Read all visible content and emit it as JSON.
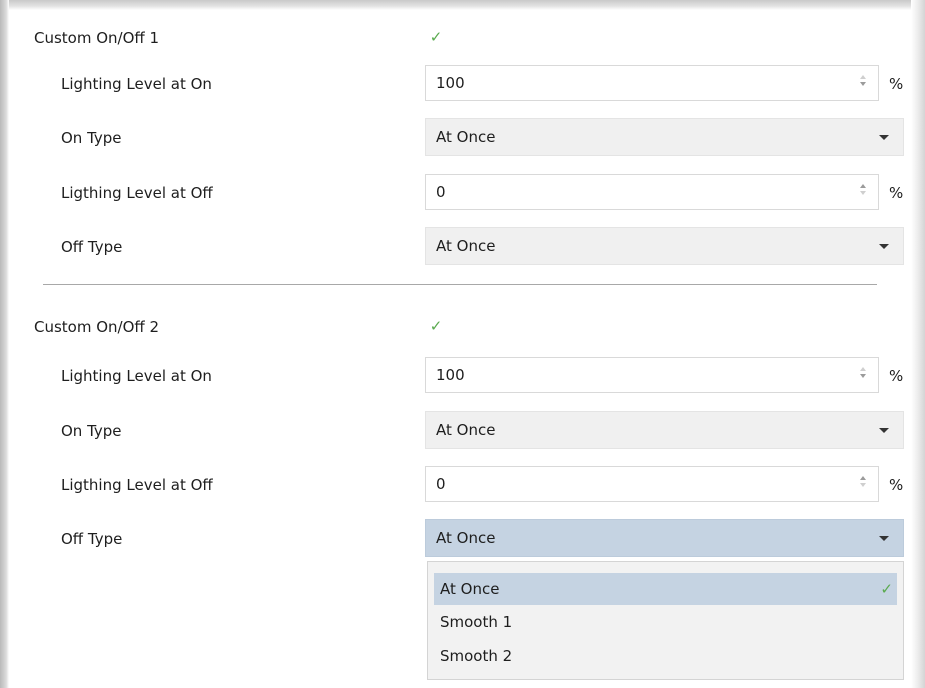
{
  "sections": [
    {
      "title": "Custom On/Off 1",
      "checkbox_checked": true,
      "fields": {
        "on_level": {
          "label": "Lighting Level at On",
          "value": "100",
          "unit": "%"
        },
        "on_type": {
          "label": "On Type",
          "value": "At Once"
        },
        "off_level": {
          "label": "Ligthing Level at Off",
          "value": "0",
          "unit": "%"
        },
        "off_type": {
          "label": "Off Type",
          "value": "At Once"
        }
      }
    },
    {
      "title": "Custom On/Off 2",
      "checkbox_checked": true,
      "fields": {
        "on_level": {
          "label": "Lighting Level at On",
          "value": "100",
          "unit": "%"
        },
        "on_type": {
          "label": "On Type",
          "value": "At Once"
        },
        "off_level": {
          "label": "Ligthing Level at Off",
          "value": "0",
          "unit": "%"
        },
        "off_type": {
          "label": "Off Type",
          "value": "At Once"
        }
      }
    }
  ],
  "dropdown_menu": {
    "options": [
      "At Once",
      "Smooth 1",
      "Smooth 2"
    ],
    "selected": "At Once"
  },
  "icons": {
    "checkbox": "check-icon",
    "spinner_up": "arrow-up-icon",
    "spinner_down": "arrow-down-icon",
    "dropdown": "caret-down-icon",
    "menu_selected": "check-icon"
  },
  "colors": {
    "check_green": "#5aaa4f",
    "dropdown_bg": "#f0f0f0",
    "active_highlight": "#c5d3e2"
  }
}
